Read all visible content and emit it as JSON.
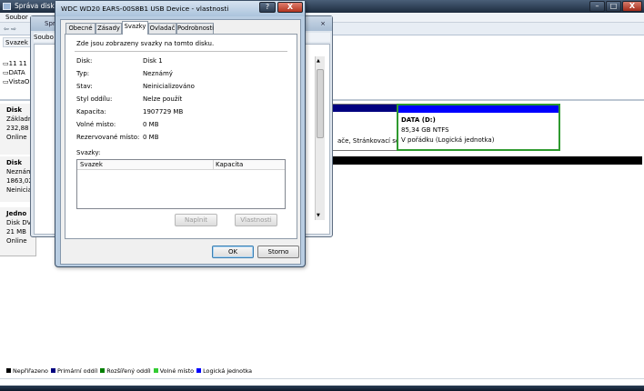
{
  "main_window": {
    "title": "Správa disků",
    "menu_peek": "Soubor",
    "toolbar_peek": "⇦ ⇨",
    "controls": {
      "minimize": "–",
      "maximize": "□",
      "close": "X"
    }
  },
  "volume_list": {
    "header_visible": "Svazek",
    "rows": [
      "11 11",
      "DATA",
      "VistaO"
    ]
  },
  "disks": [
    {
      "name": "Disk",
      "type": "Základn",
      "size": "232,88",
      "status": "Online"
    },
    {
      "name": "Disk",
      "type": "Neznám",
      "size": "1863,02",
      "status": "Neinicial"
    },
    {
      "name": "Jedno",
      "type": "Disk DV",
      "size": "21 MB",
      "status": "Online"
    }
  ],
  "partition_d": {
    "name": "DATA  (D:)",
    "size_fs": "85,34 GB NTFS",
    "status": "V pořádku (Logická jednotka)"
  },
  "partition_left_text": "ače, Stránkovací sou",
  "legend": [
    {
      "label": "Nepřiřazeno",
      "color": "#000000"
    },
    {
      "label": "Primární oddíl",
      "color": "#00007f"
    },
    {
      "label": "Rozšířený oddíl",
      "color": "#007f00"
    },
    {
      "label": "Volné místo",
      "color": "#33cc33"
    },
    {
      "label": "Logická jednotka",
      "color": "#0000ff"
    }
  ],
  "background_window": {
    "title_peek": "Spr",
    "menu_peek": "Soubo",
    "close": "⨯"
  },
  "dialog": {
    "title": "WDC WD20 EARS-00S8B1 USB Device - vlastnosti",
    "help": "?",
    "close": "X",
    "tabs": [
      "Obecné",
      "Zásady",
      "Svazky",
      "Ovladač",
      "Podrobnosti"
    ],
    "active_tab": "Svazky",
    "intro": "Zde jsou zobrazeny svazky na tomto disku.",
    "properties": [
      {
        "label": "Disk:",
        "value": "Disk 1"
      },
      {
        "label": "Typ:",
        "value": "Neznámý"
      },
      {
        "label": "Stav:",
        "value": "Neinicializováno"
      },
      {
        "label": "Styl oddílu:",
        "value": "Nelze použít"
      },
      {
        "label": "Kapacita:",
        "value": "1907729 MB"
      },
      {
        "label": "Volné místo:",
        "value": "0 MB"
      },
      {
        "label": "Rezervované místo:",
        "value": "0 MB"
      }
    ],
    "volumes_label": "Svazky:",
    "volumes_columns": [
      "Svazek",
      "Kapacita"
    ],
    "buttons": {
      "fill": "Naplnit",
      "properties": "Vlastnosti",
      "ok": "OK",
      "cancel": "Storno"
    }
  },
  "colors": {
    "primary": "#00007f",
    "logical": "#0000ff",
    "extended": "#007f00",
    "unallocated": "#000000"
  }
}
